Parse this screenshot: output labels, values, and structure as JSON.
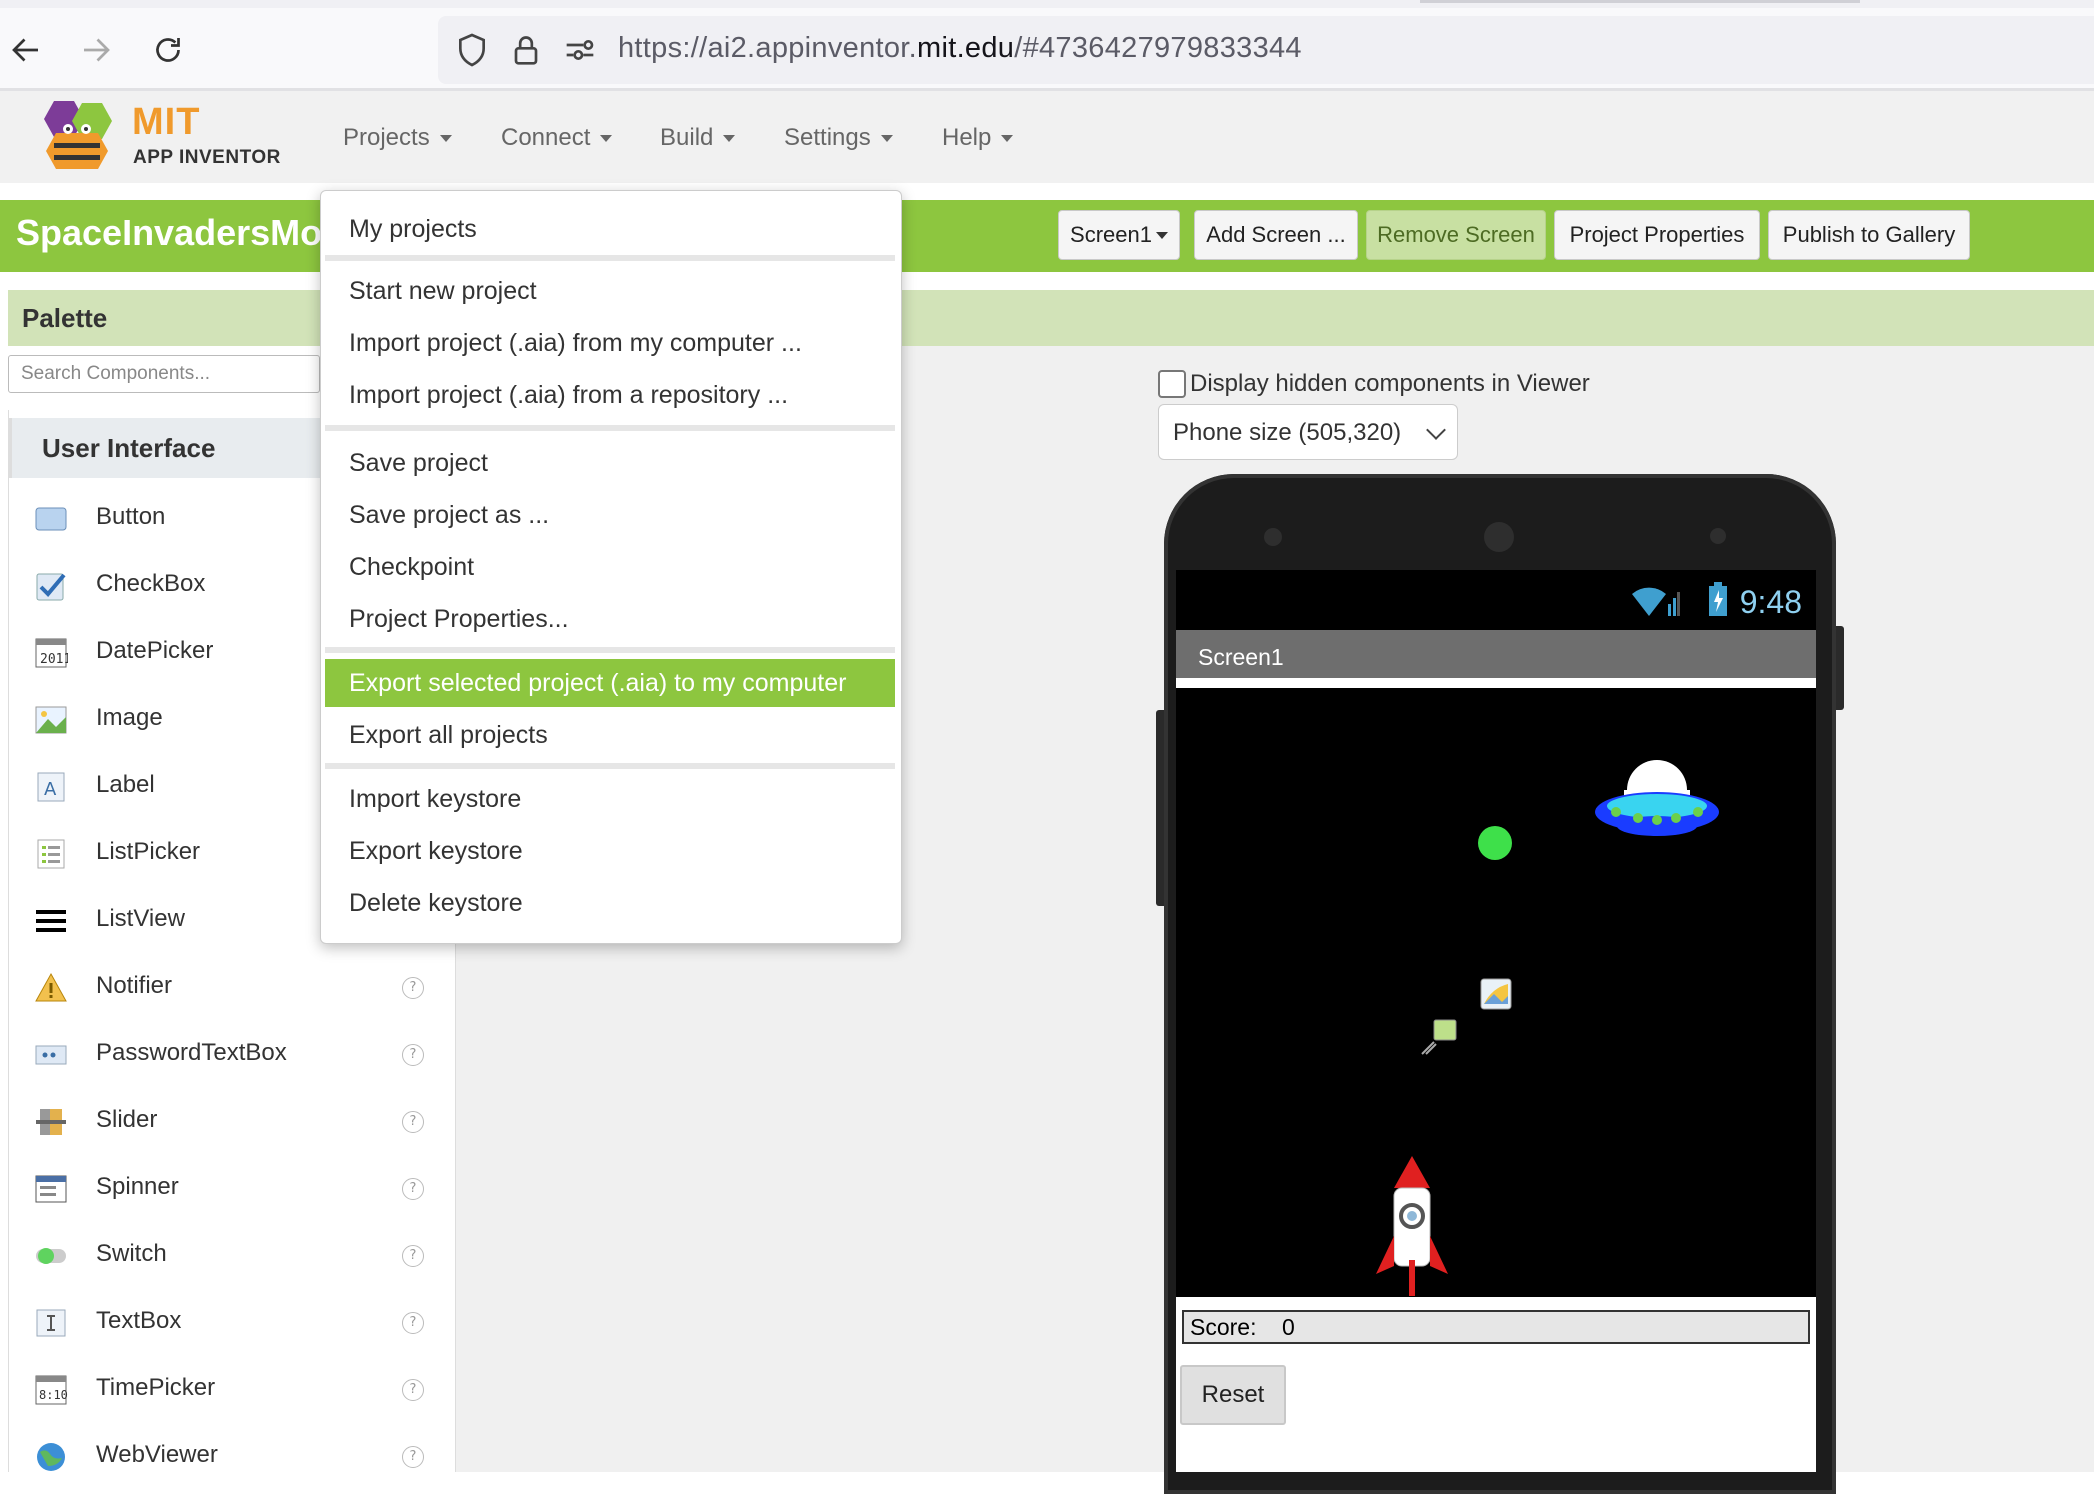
{
  "browser": {
    "url_prefix": "https://ai2.appinventor.",
    "url_host": "mit.edu",
    "url_suffix": "/#4736427979833344"
  },
  "header": {
    "logo_mit": "MIT",
    "logo_sub": "APP INVENTOR",
    "menus": [
      "Projects",
      "Connect",
      "Build",
      "Settings",
      "Help"
    ]
  },
  "project_bar": {
    "title": "SpaceInvadersMod",
    "screen_select": "Screen1",
    "add_screen": "Add Screen ...",
    "remove_screen": "Remove Screen",
    "project_properties": "Project Properties",
    "publish": "Publish to Gallery"
  },
  "palette": {
    "title": "Palette",
    "search_placeholder": "Search Components...",
    "section": "User Interface",
    "components": [
      {
        "label": "Button",
        "icon": "button-icon"
      },
      {
        "label": "CheckBox",
        "icon": "checkbox-icon"
      },
      {
        "label": "DatePicker",
        "icon": "datepicker-icon"
      },
      {
        "label": "Image",
        "icon": "image-icon"
      },
      {
        "label": "Label",
        "icon": "label-icon"
      },
      {
        "label": "ListPicker",
        "icon": "listpicker-icon"
      },
      {
        "label": "ListView",
        "icon": "listview-icon"
      },
      {
        "label": "Notifier",
        "icon": "notifier-icon"
      },
      {
        "label": "PasswordTextBox",
        "icon": "passwordtextbox-icon"
      },
      {
        "label": "Slider",
        "icon": "slider-icon"
      },
      {
        "label": "Spinner",
        "icon": "spinner-icon"
      },
      {
        "label": "Switch",
        "icon": "switch-icon"
      },
      {
        "label": "TextBox",
        "icon": "textbox-icon"
      },
      {
        "label": "TimePicker",
        "icon": "timepicker-icon"
      },
      {
        "label": "WebViewer",
        "icon": "webviewer-icon"
      }
    ],
    "help_glyph": "?"
  },
  "viewer": {
    "hidden_components_label": "Display hidden components in Viewer",
    "size_select": "Phone size (505,320)",
    "status_time": "9:48",
    "screen_title": "Screen1",
    "score_label": "Score:",
    "score_value": "0",
    "reset_button": "Reset"
  },
  "projects_menu": {
    "items": [
      "My projects",
      "Start new project",
      "Import project (.aia) from my computer ...",
      "Import project (.aia) from a repository ...",
      "Save project",
      "Save project as ...",
      "Checkpoint",
      "Project Properties...",
      "Export selected project (.aia) to my computer",
      "Export all projects",
      "Import keystore",
      "Export keystore",
      "Delete keystore"
    ],
    "selected_index": 8
  },
  "colors": {
    "accent_green": "#8dc63f",
    "palette_header": "#d2e3b8",
    "logo_orange": "#f09a2c"
  }
}
